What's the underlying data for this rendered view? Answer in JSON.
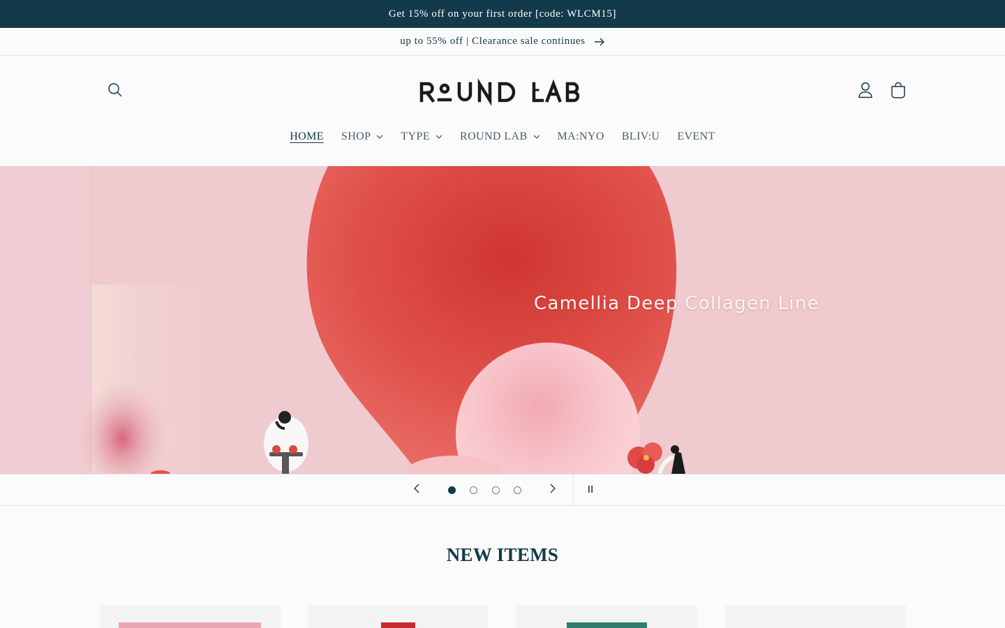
{
  "announcement": {
    "top_text": "Get 15% off on your first order [code: WLCM15]",
    "sub_text": "up to 55% off | Clearance sale continues"
  },
  "header": {
    "logo_text": "ROUND LAB",
    "nav": [
      {
        "label": "HOME",
        "active": true,
        "has_dropdown": false
      },
      {
        "label": "SHOP",
        "active": false,
        "has_dropdown": true
      },
      {
        "label": "TYPE",
        "active": false,
        "has_dropdown": true
      },
      {
        "label": "ROUND LAB",
        "active": false,
        "has_dropdown": true
      },
      {
        "label": "MA:NYO",
        "active": false,
        "has_dropdown": false
      },
      {
        "label": "BLIV:U",
        "active": false,
        "has_dropdown": false
      },
      {
        "label": "EVENT",
        "active": false,
        "has_dropdown": false
      }
    ],
    "icons": [
      "search-icon",
      "account-icon",
      "cart-icon"
    ]
  },
  "hero": {
    "slide_title": "Camellia Deep Collagen Line",
    "slide_count": 4,
    "current_slide": 1
  },
  "section": {
    "title": "NEW ITEMS"
  },
  "colors": {
    "brand_dark": "#133a4b",
    "hero_bg": "#efcbd0",
    "accent_red": "#dd4440",
    "card_bg": "#f3f3f3"
  },
  "products": [
    {
      "accent": "#eaa6b0"
    },
    {
      "accent": "#c52a2e"
    },
    {
      "accent": "#2e7d6e"
    },
    {
      "accent": "#f3f3f3"
    }
  ]
}
